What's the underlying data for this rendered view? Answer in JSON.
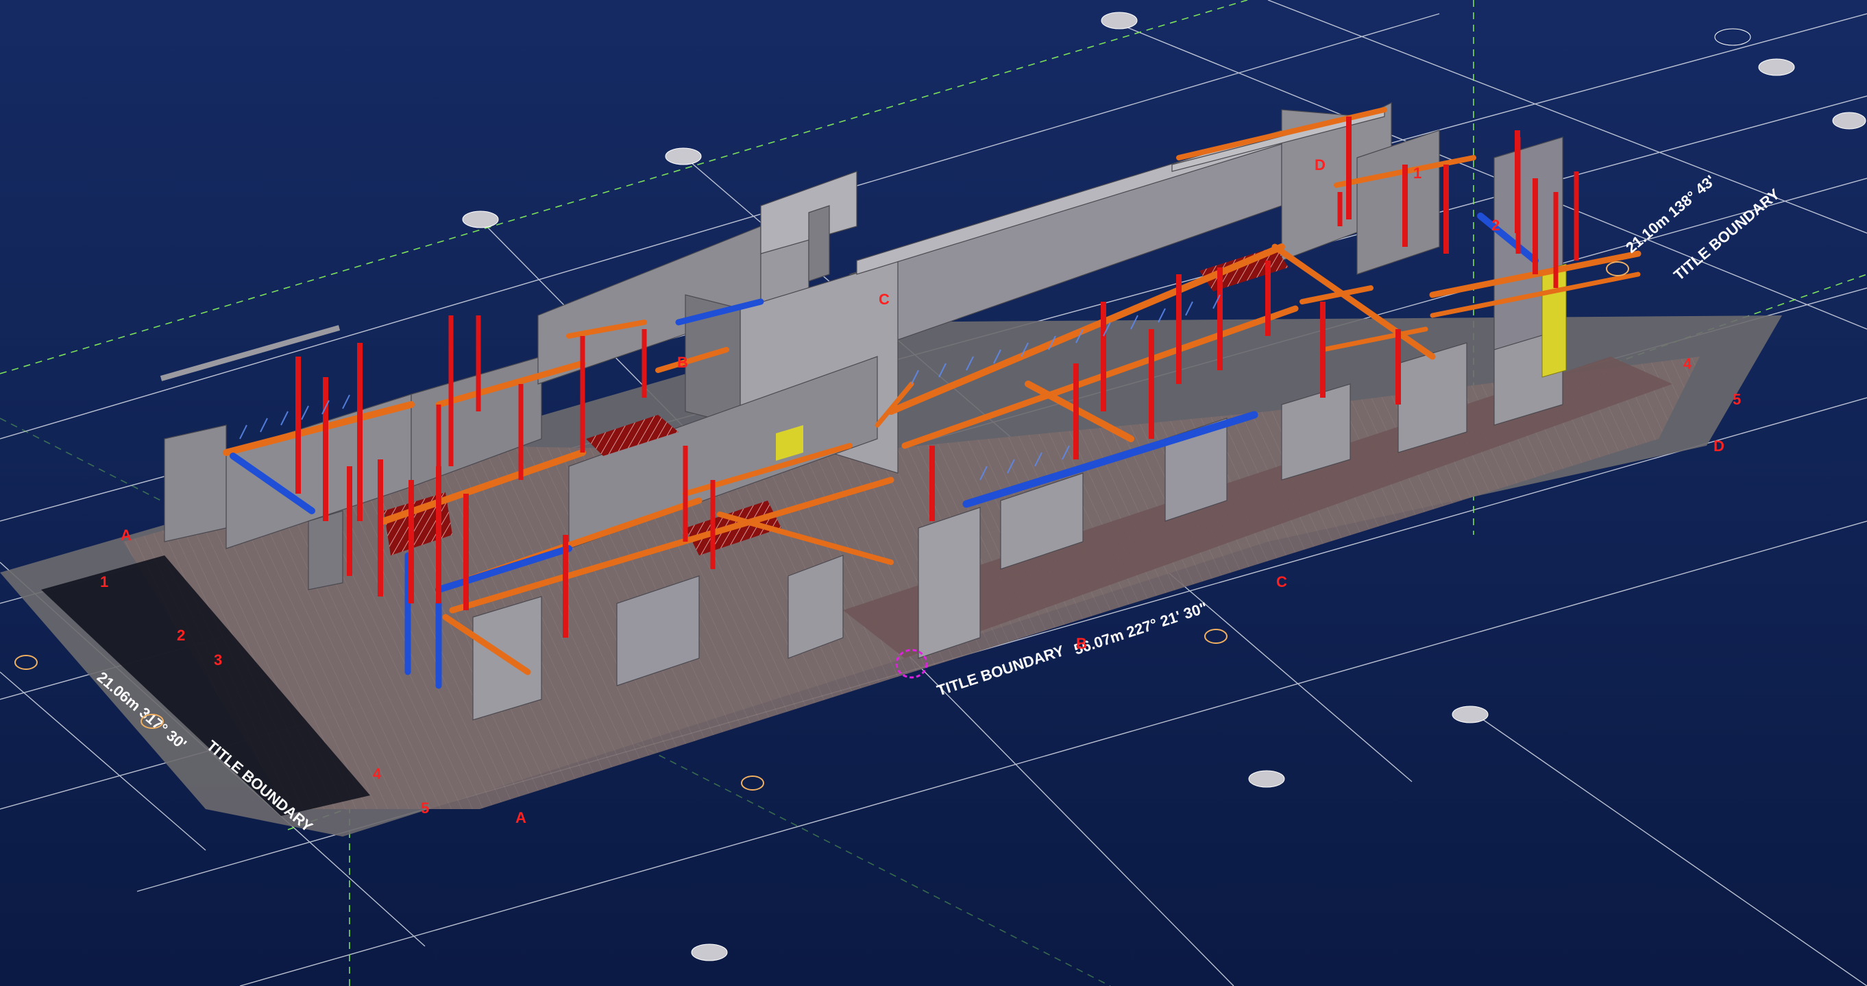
{
  "viewport": {
    "background": "#132a5f",
    "colors": {
      "wall": "#8a8890",
      "wall_dark": "#6c6b72",
      "wall_light": "#a3a2a8",
      "column": "#e01414",
      "beam_orange": "#e56d1a",
      "beam_blue": "#1f4fd6",
      "yellow_panel": "#d8d22a",
      "grid_line": "#d9dde8",
      "dashed_line": "#7be05a",
      "label_red": "#ff2020",
      "slab": "#7a6a6a"
    }
  },
  "labels": {
    "title_boundary_front": "TITLE BOUNDARY",
    "bearing_front": "56.07m 227° 21' 30\"",
    "title_boundary_left": "TITLE BOUNDARY",
    "bearing_left": "21.06m 317° 30'",
    "title_boundary_right": "TITLE BOUNDARY",
    "bearing_right": "21.10m 138° 43'"
  },
  "grid_markers": {
    "A_left": "A",
    "A_bottom": "A",
    "B_mid": "B",
    "B_bottom": "B",
    "C_mid": "C",
    "C_front": "C",
    "D_top": "D",
    "D_right": "D",
    "n1_left": "1",
    "n1_top": "1",
    "n2_left": "2",
    "n2_right": "2",
    "n3_left": "3",
    "n4_left": "4",
    "n4_right": "4",
    "n5_left": "5",
    "n5_right": "5"
  }
}
